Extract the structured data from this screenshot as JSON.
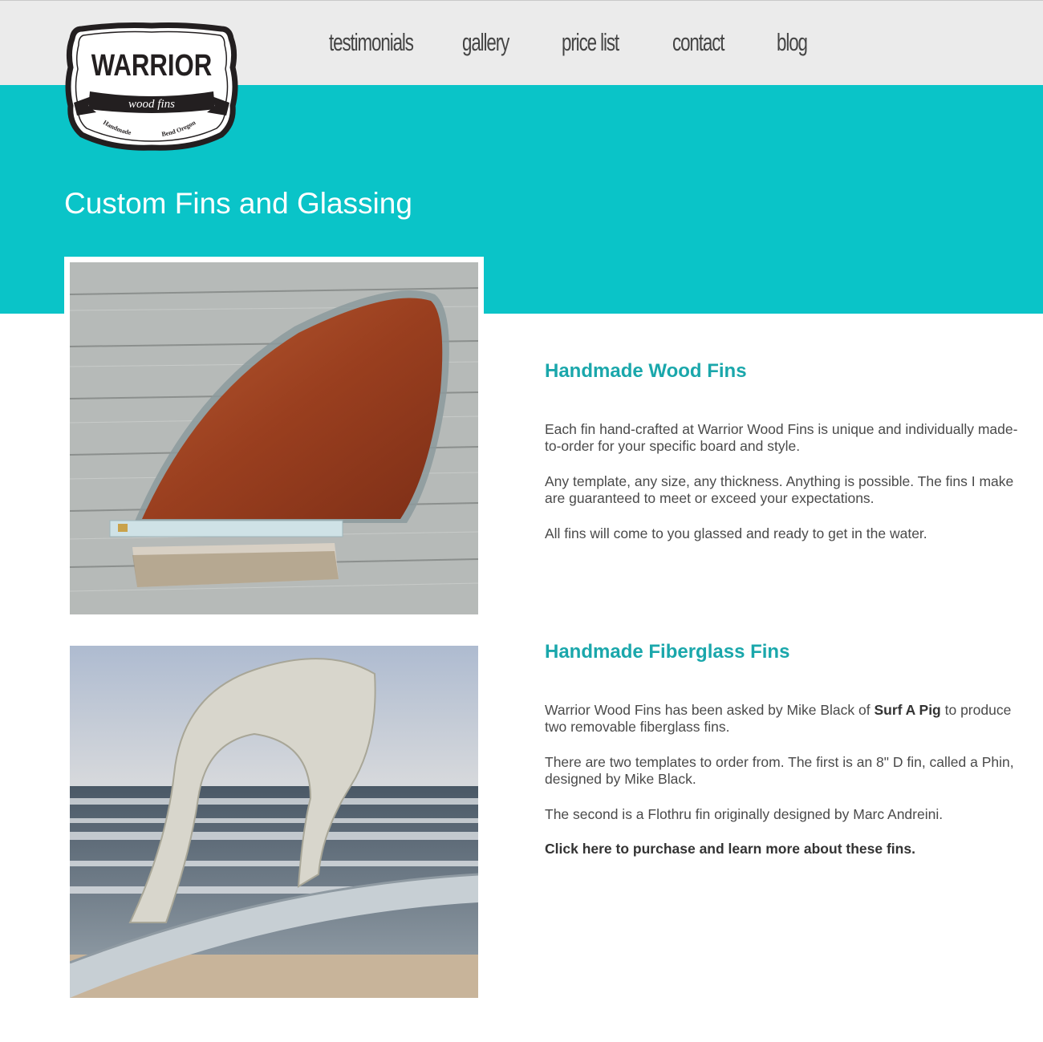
{
  "logo": {
    "brand": "WARRIOR",
    "sub": "wood fins",
    "left_tag": "Handmade",
    "right_tag": "Bend Oregon"
  },
  "nav": [
    {
      "label": "testimonials"
    },
    {
      "label": "gallery"
    },
    {
      "label": "price list"
    },
    {
      "label": "contact"
    },
    {
      "label": "blog"
    }
  ],
  "page": {
    "title": "Custom Fins and Glassing"
  },
  "sections": [
    {
      "heading": "Handmade Wood Fins",
      "paragraphs": [
        "Each fin hand-crafted at Warrior Wood Fins is unique and individually made-to-order for your specific board and style.",
        "Any template, any size, any thickness. Anything is possible. The fins I make are guaranteed to meet or exceed your expectations.",
        "All fins will come to you glassed and ready to get in the water."
      ]
    },
    {
      "heading": "Handmade Fiberglass Fins",
      "p1_before": "Warrior Wood Fins has been asked by Mike Black of ",
      "p1_bold": "Surf A Pig",
      "p1_after": " to produce two removable fiberglass fins.",
      "p2": "There are two templates to order from. The first is an 8\" D fin, called a Phin, designed by Mike Black.",
      "p3": "The second is a Flothru fin originally designed by Marc Andreini.",
      "link": "Click here to purchase and learn more about these fins."
    }
  ],
  "colors": {
    "accent": "#0ac4c8",
    "heading": "#1aa7ab",
    "header_bg": "#ebebeb",
    "text": "#4a4a4a"
  }
}
